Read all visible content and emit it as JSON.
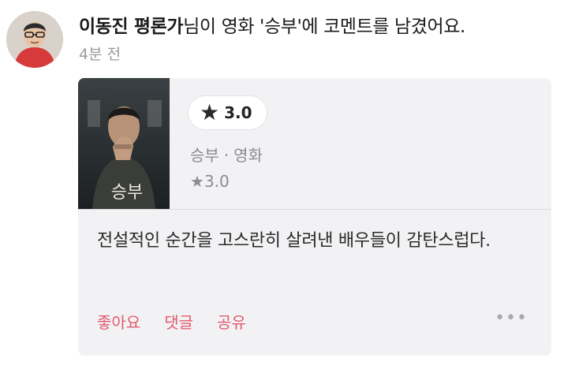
{
  "feed_item": {
    "user_name": "이동진 평론가",
    "action_text": "님이 영화 '승부'에 코멘트를 남겼어요.",
    "timestamp": "4분 전"
  },
  "movie": {
    "title": "승부",
    "category": "영화",
    "separator": "·",
    "user_rating_pill": "3.0",
    "average_rating": "3.0",
    "star_glyph": "★",
    "poster_title_text": "승부"
  },
  "comment": {
    "text": "전설적인 순간을 고스란히 살려낸 배우들이 감탄스럽다."
  },
  "actions": {
    "like_label": "좋아요",
    "reply_label": "댓글",
    "share_label": "공유",
    "more_label": "•••"
  },
  "colors": {
    "accent": "#e25a6e",
    "card_bg": "#f2f2f4",
    "muted_text": "#8c8c90"
  }
}
